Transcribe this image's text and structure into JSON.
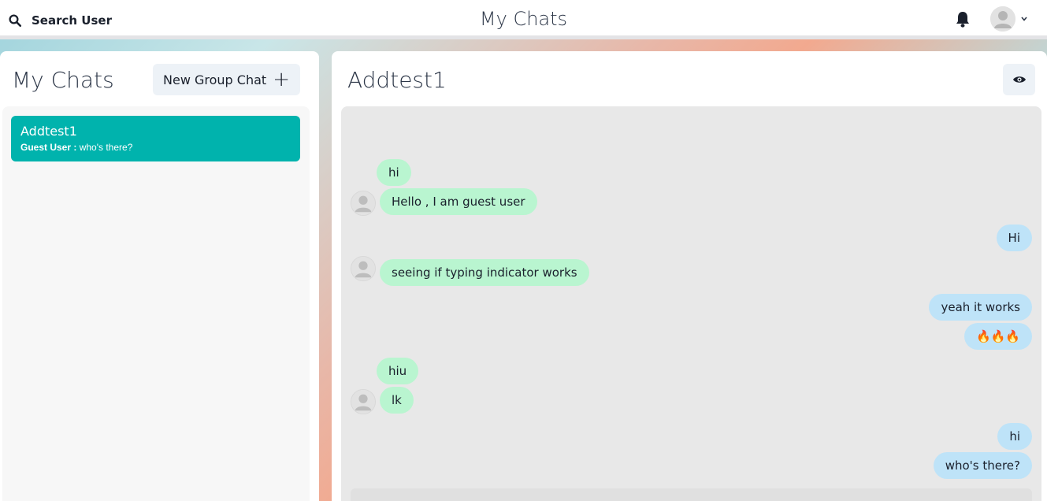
{
  "header": {
    "search_label": "Search User",
    "app_title": "My Chats"
  },
  "sidebar": {
    "title": "My Chats",
    "new_group_label": "New Group Chat",
    "chats": [
      {
        "name": "Addtest1",
        "latest_sender": "Guest User :",
        "latest_message": "who's there?",
        "selected": true
      }
    ]
  },
  "chat": {
    "title": "Addtest1",
    "messages": [
      {
        "text": "hi",
        "from": "them"
      },
      {
        "text": "Hello , I am guest user",
        "from": "them"
      },
      {
        "text": "Hi",
        "from": "me"
      },
      {
        "text": "seeing if typing indicator works",
        "from": "them"
      },
      {
        "text": "yeah it works",
        "from": "me"
      },
      {
        "text": "🔥🔥🔥",
        "from": "me"
      },
      {
        "text": "hiu",
        "from": "them"
      },
      {
        "text": "lk",
        "from": "them"
      },
      {
        "text": "hi",
        "from": "me"
      },
      {
        "text": "who's there?",
        "from": "me"
      }
    ]
  },
  "colors": {
    "selected_chat": "#00b3ad",
    "their_bubble": "#b9f5d0",
    "my_bubble": "#bee3f8"
  }
}
